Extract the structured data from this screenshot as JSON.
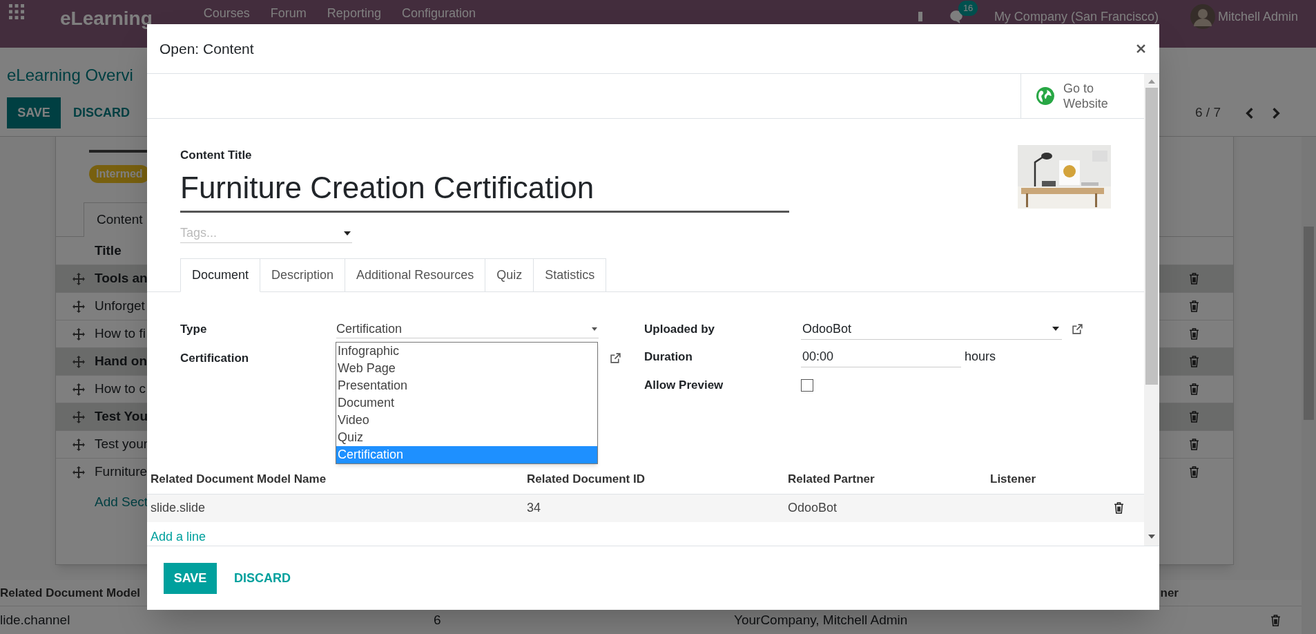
{
  "navbar": {
    "app_name": "eLearning",
    "menus": [
      "Courses",
      "Forum",
      "Reporting",
      "Configuration"
    ],
    "chat_count": "16",
    "company": "My Company (San Francisco)",
    "user": "Mitchell Admin"
  },
  "control_panel": {
    "breadcrumb": "eLearning Overvi",
    "buttons": [
      "SAVE",
      "DISCARD"
    ],
    "pager": "6 / 7"
  },
  "course": {
    "level_badge": "Intermed",
    "tab": "Content",
    "column_title": "Title",
    "rows": [
      {
        "title": "Tools an",
        "kind": "section"
      },
      {
        "title": "Unforget",
        "kind": "content"
      },
      {
        "title": "How to fi",
        "kind": "content"
      },
      {
        "title": "Hand on",
        "kind": "section"
      },
      {
        "title": "How to c",
        "kind": "content"
      },
      {
        "title": "Test You",
        "kind": "section"
      },
      {
        "title": "Test your",
        "kind": "content"
      },
      {
        "title": "Furniture",
        "kind": "content"
      }
    ],
    "add_link": "Add Sect"
  },
  "bottom_table": {
    "columns": [
      "Related Document Model",
      "ner"
    ],
    "rows": [
      {
        "model": "lide.channel",
        "id": "6",
        "partner": "YourCompany, Mitchell Admin"
      }
    ]
  },
  "dialog": {
    "title": "Open: Content",
    "go_to_website": "Go to\nWebsite",
    "content_title_label": "Content Title",
    "content_title": "Furniture Creation Certification",
    "tags_placeholder": "Tags...",
    "tabs": [
      {
        "label": "Document",
        "selected": true
      },
      {
        "label": "Description",
        "selected": false
      },
      {
        "label": "Additional Resources",
        "selected": false
      },
      {
        "label": "Quiz",
        "selected": false
      },
      {
        "label": "Statistics",
        "selected": false
      }
    ],
    "type": {
      "label": "Type",
      "value": "Certification",
      "options": [
        {
          "label": "Infographic",
          "selected": false
        },
        {
          "label": "Web Page",
          "selected": false
        },
        {
          "label": "Presentation",
          "selected": false
        },
        {
          "label": "Document",
          "selected": false
        },
        {
          "label": "Video",
          "selected": false
        },
        {
          "label": "Quiz",
          "selected": false
        },
        {
          "label": "Certification",
          "selected": true
        }
      ]
    },
    "certification_label": "Certification",
    "uploaded_by": {
      "label": "Uploaded by",
      "value": "OdooBot"
    },
    "duration": {
      "label": "Duration",
      "value": "00:00",
      "unit": "hours"
    },
    "allow_preview": {
      "label": "Allow Preview",
      "checked": false
    },
    "related_table": {
      "columns": [
        "Related Document Model Name",
        "Related Document ID",
        "Related Partner",
        "Listener"
      ],
      "rows": [
        {
          "model": "slide.slide",
          "id": "34",
          "partner": "OdooBot"
        }
      ]
    },
    "add_line": "Add a line",
    "buttons": [
      "SAVE",
      "DISCARD"
    ]
  }
}
